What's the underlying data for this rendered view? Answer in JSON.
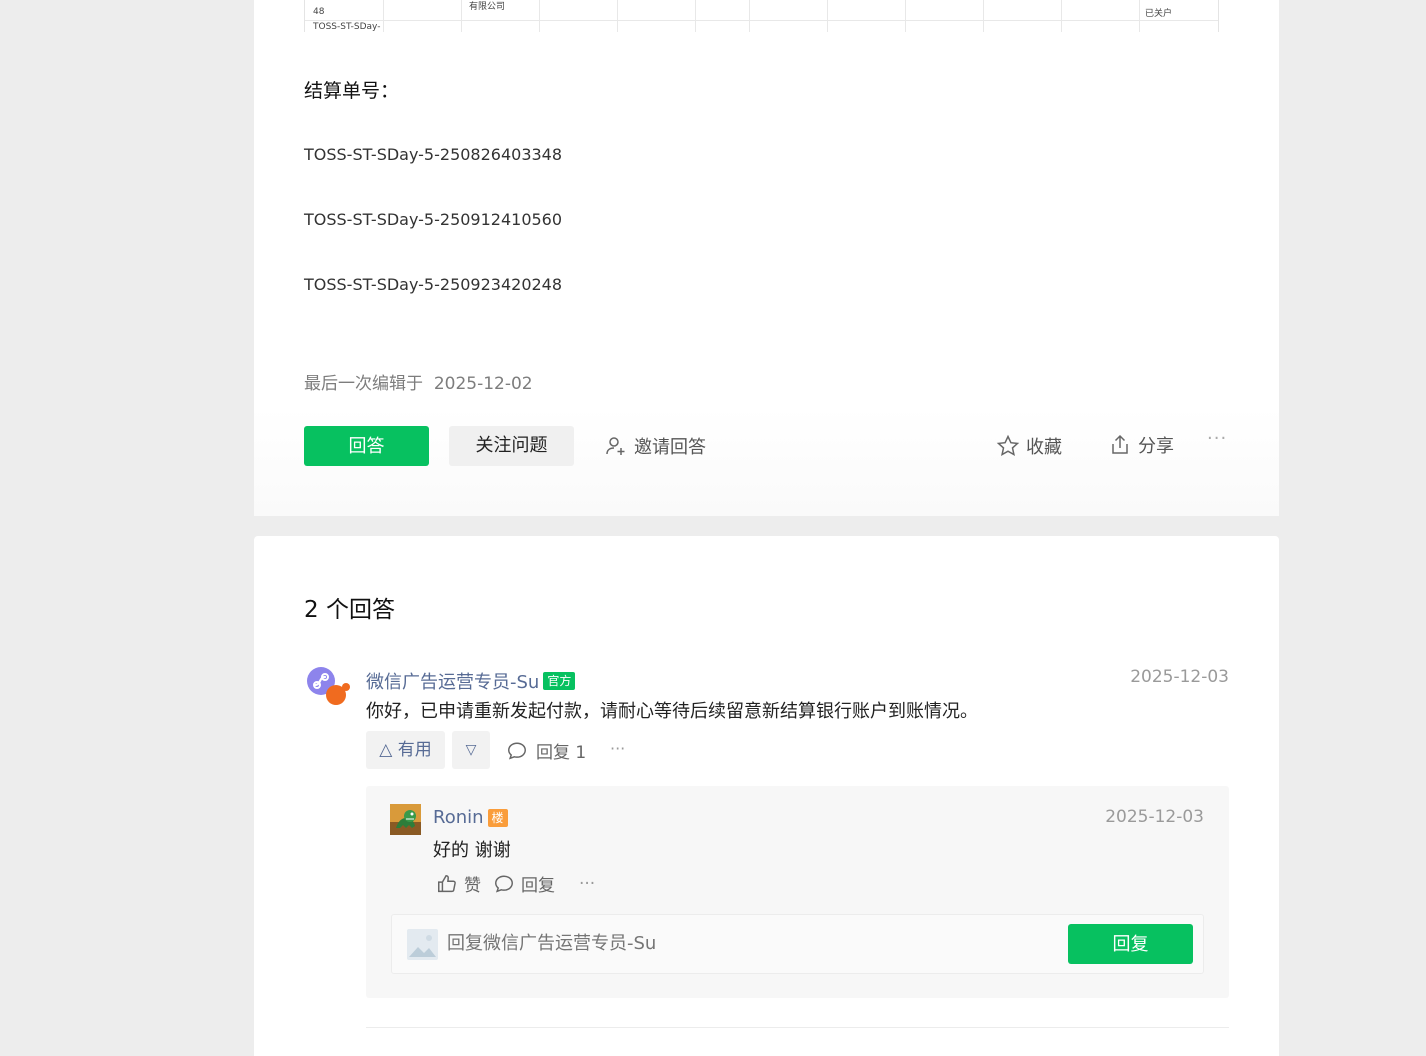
{
  "table_fragment": {
    "cells": [
      {
        "text": "48"
      },
      {
        "text": "有限公司"
      },
      {
        "text": "TOSS-ST-SDay-"
      },
      {
        "text": "已关户"
      }
    ]
  },
  "question": {
    "label_title": "结算单号：",
    "orders": [
      "TOSS-ST-SDay-5-250826403348",
      "TOSS-ST-SDay-5-250912410560",
      "TOSS-ST-SDay-5-250923420248"
    ],
    "last_edited_prefix": "最后一次编辑于",
    "last_edited_date": "2025-12-02"
  },
  "actions": {
    "answer": "回答",
    "follow": "关注问题",
    "invite": "邀请回答",
    "collect": "收藏",
    "share": "分享",
    "more": "···"
  },
  "answers": {
    "count_label": "2 个回答",
    "items": [
      {
        "author": "微信广告运营专员-Su",
        "badge": "官方",
        "date": "2025-12-03",
        "content": "你好，已申请重新发起付款，请耐心等待后续留意新结算银行账户到账情况。",
        "useful": "△ 有用",
        "downvote": "▽",
        "reply": "回复 1",
        "more": "···",
        "replies": [
          {
            "author": "Ronin",
            "badge": "楼",
            "date": "2025-12-03",
            "content": "好的 谢谢",
            "like": "赞",
            "reply": "回复",
            "more": "···"
          }
        ],
        "reply_input": {
          "placeholder": "回复微信广告运营专员-Su",
          "submit": "回复"
        }
      }
    ]
  },
  "colors": {
    "accent": "#07c160",
    "link": "#576b95",
    "badge_floor": "#fa9d3b",
    "page_bg": "#ededed"
  },
  "icons": {
    "invite": "person-add-icon",
    "collect": "star-icon",
    "share": "share-icon",
    "comment": "comment-bubble-icon",
    "like": "thumb-up-icon"
  }
}
